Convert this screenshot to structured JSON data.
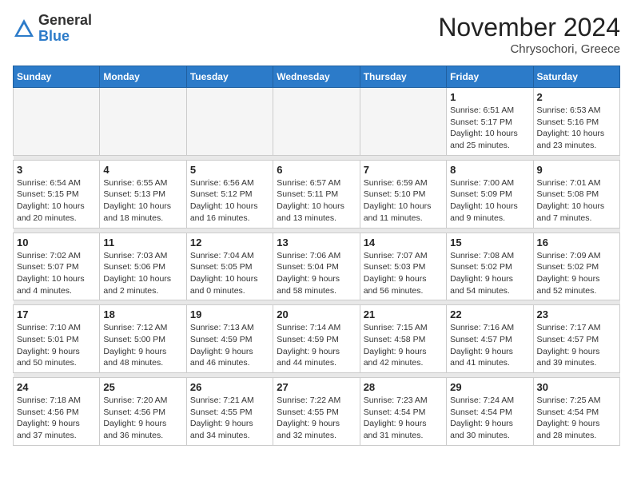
{
  "logo": {
    "general": "General",
    "blue": "Blue"
  },
  "title": "November 2024",
  "subtitle": "Chrysochori, Greece",
  "days_of_week": [
    "Sunday",
    "Monday",
    "Tuesday",
    "Wednesday",
    "Thursday",
    "Friday",
    "Saturday"
  ],
  "weeks": [
    [
      {
        "day": "",
        "info": ""
      },
      {
        "day": "",
        "info": ""
      },
      {
        "day": "",
        "info": ""
      },
      {
        "day": "",
        "info": ""
      },
      {
        "day": "",
        "info": ""
      },
      {
        "day": "1",
        "info": "Sunrise: 6:51 AM\nSunset: 5:17 PM\nDaylight: 10 hours\nand 25 minutes."
      },
      {
        "day": "2",
        "info": "Sunrise: 6:53 AM\nSunset: 5:16 PM\nDaylight: 10 hours\nand 23 minutes."
      }
    ],
    [
      {
        "day": "3",
        "info": "Sunrise: 6:54 AM\nSunset: 5:15 PM\nDaylight: 10 hours\nand 20 minutes."
      },
      {
        "day": "4",
        "info": "Sunrise: 6:55 AM\nSunset: 5:13 PM\nDaylight: 10 hours\nand 18 minutes."
      },
      {
        "day": "5",
        "info": "Sunrise: 6:56 AM\nSunset: 5:12 PM\nDaylight: 10 hours\nand 16 minutes."
      },
      {
        "day": "6",
        "info": "Sunrise: 6:57 AM\nSunset: 5:11 PM\nDaylight: 10 hours\nand 13 minutes."
      },
      {
        "day": "7",
        "info": "Sunrise: 6:59 AM\nSunset: 5:10 PM\nDaylight: 10 hours\nand 11 minutes."
      },
      {
        "day": "8",
        "info": "Sunrise: 7:00 AM\nSunset: 5:09 PM\nDaylight: 10 hours\nand 9 minutes."
      },
      {
        "day": "9",
        "info": "Sunrise: 7:01 AM\nSunset: 5:08 PM\nDaylight: 10 hours\nand 7 minutes."
      }
    ],
    [
      {
        "day": "10",
        "info": "Sunrise: 7:02 AM\nSunset: 5:07 PM\nDaylight: 10 hours\nand 4 minutes."
      },
      {
        "day": "11",
        "info": "Sunrise: 7:03 AM\nSunset: 5:06 PM\nDaylight: 10 hours\nand 2 minutes."
      },
      {
        "day": "12",
        "info": "Sunrise: 7:04 AM\nSunset: 5:05 PM\nDaylight: 10 hours\nand 0 minutes."
      },
      {
        "day": "13",
        "info": "Sunrise: 7:06 AM\nSunset: 5:04 PM\nDaylight: 9 hours\nand 58 minutes."
      },
      {
        "day": "14",
        "info": "Sunrise: 7:07 AM\nSunset: 5:03 PM\nDaylight: 9 hours\nand 56 minutes."
      },
      {
        "day": "15",
        "info": "Sunrise: 7:08 AM\nSunset: 5:02 PM\nDaylight: 9 hours\nand 54 minutes."
      },
      {
        "day": "16",
        "info": "Sunrise: 7:09 AM\nSunset: 5:02 PM\nDaylight: 9 hours\nand 52 minutes."
      }
    ],
    [
      {
        "day": "17",
        "info": "Sunrise: 7:10 AM\nSunset: 5:01 PM\nDaylight: 9 hours\nand 50 minutes."
      },
      {
        "day": "18",
        "info": "Sunrise: 7:12 AM\nSunset: 5:00 PM\nDaylight: 9 hours\nand 48 minutes."
      },
      {
        "day": "19",
        "info": "Sunrise: 7:13 AM\nSunset: 4:59 PM\nDaylight: 9 hours\nand 46 minutes."
      },
      {
        "day": "20",
        "info": "Sunrise: 7:14 AM\nSunset: 4:59 PM\nDaylight: 9 hours\nand 44 minutes."
      },
      {
        "day": "21",
        "info": "Sunrise: 7:15 AM\nSunset: 4:58 PM\nDaylight: 9 hours\nand 42 minutes."
      },
      {
        "day": "22",
        "info": "Sunrise: 7:16 AM\nSunset: 4:57 PM\nDaylight: 9 hours\nand 41 minutes."
      },
      {
        "day": "23",
        "info": "Sunrise: 7:17 AM\nSunset: 4:57 PM\nDaylight: 9 hours\nand 39 minutes."
      }
    ],
    [
      {
        "day": "24",
        "info": "Sunrise: 7:18 AM\nSunset: 4:56 PM\nDaylight: 9 hours\nand 37 minutes."
      },
      {
        "day": "25",
        "info": "Sunrise: 7:20 AM\nSunset: 4:56 PM\nDaylight: 9 hours\nand 36 minutes."
      },
      {
        "day": "26",
        "info": "Sunrise: 7:21 AM\nSunset: 4:55 PM\nDaylight: 9 hours\nand 34 minutes."
      },
      {
        "day": "27",
        "info": "Sunrise: 7:22 AM\nSunset: 4:55 PM\nDaylight: 9 hours\nand 32 minutes."
      },
      {
        "day": "28",
        "info": "Sunrise: 7:23 AM\nSunset: 4:54 PM\nDaylight: 9 hours\nand 31 minutes."
      },
      {
        "day": "29",
        "info": "Sunrise: 7:24 AM\nSunset: 4:54 PM\nDaylight: 9 hours\nand 30 minutes."
      },
      {
        "day": "30",
        "info": "Sunrise: 7:25 AM\nSunset: 4:54 PM\nDaylight: 9 hours\nand 28 minutes."
      }
    ]
  ]
}
